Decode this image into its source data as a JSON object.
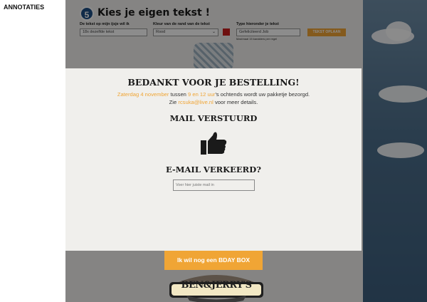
{
  "annotations": {
    "title": "ANNOTATIES"
  },
  "step": {
    "number": "5",
    "title": "Kies je eigen tekst !",
    "text_label": "De tekst op mijn ijsje wil ik",
    "text_value": "18x dezelfde tekst",
    "border_label": "Kleur van de rand van de tekst",
    "border_value": "Rood",
    "border_color": "#c81e1e",
    "type_label": "Type hieronder je tekst",
    "type_value": "Gefeliciteerd Job",
    "hint": "Maximaal 15 karakters per regel",
    "preview_button": "TEKST OPLAAN"
  },
  "modal": {
    "title": "BEDANKT VOOR JE BESTELLING!",
    "date": "Zaterdag 4 november",
    "between": " tussen ",
    "time": "9 en 12 uur",
    "delivery_rest": "'s ochtends wordt uw pakketje bezorgd.",
    "see": "Zie ",
    "email": "rcsuka@live.nl",
    "see_rest": " voor meer details.",
    "mail_sent": "MAIL VERSTUURD",
    "thumb_icon": "thumbs-up-icon",
    "email_wrong": "E-MAIL VERKEERD?",
    "mail_input_placeholder": "Voer hier juiste mail in"
  },
  "cta": {
    "label": "Ik wil nog een BDAY BOX"
  },
  "logo": {
    "name": "ben-and-jerrys-logo",
    "text": "BEN&JERRY'S"
  },
  "colors": {
    "accent": "#f0a535",
    "step_badge": "#1e4f86",
    "modal_bg": "#f0efec",
    "sky": "#4d6f8c"
  }
}
